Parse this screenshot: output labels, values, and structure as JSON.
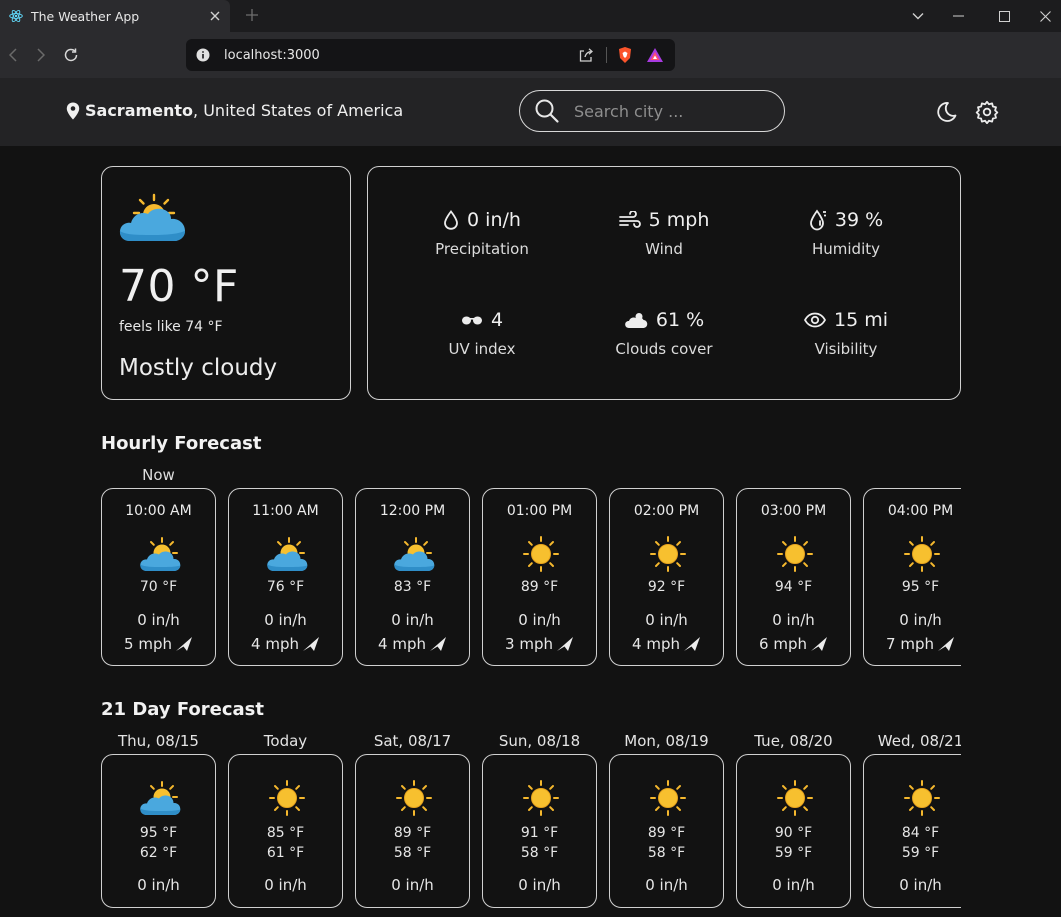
{
  "browser": {
    "tab_title": "The Weather App",
    "url": "localhost:3000"
  },
  "header": {
    "city": "Sacramento",
    "country": ", United States of America",
    "search_placeholder": "Search city ..."
  },
  "current": {
    "temperature": "70 °F",
    "feels_like": "feels like 74 °F",
    "condition": "Mostly cloudy",
    "icon": "partly-cloudy-icon"
  },
  "details": [
    {
      "value": "0 in/h",
      "label": "Precipitation",
      "icon": "droplet-icon"
    },
    {
      "value": "5 mph",
      "label": "Wind",
      "icon": "wind-icon"
    },
    {
      "value": "39 %",
      "label": "Humidity",
      "icon": "humidity-icon"
    },
    {
      "value": "4",
      "label": "UV index",
      "icon": "sunglasses-icon"
    },
    {
      "value": "61 %",
      "label": "Clouds cover",
      "icon": "cloud-sun-icon"
    },
    {
      "value": "15 mi",
      "label": "Visibility",
      "icon": "eye-icon"
    }
  ],
  "hourly": {
    "title": "Hourly Forecast",
    "now_label": "Now",
    "items": [
      {
        "time": "10:00 AM",
        "temp": "70 °F",
        "precip": "0 in/h",
        "wind": "5 mph",
        "icon": "partly-cloudy"
      },
      {
        "time": "11:00 AM",
        "temp": "76 °F",
        "precip": "0 in/h",
        "wind": "4 mph",
        "icon": "partly-cloudy"
      },
      {
        "time": "12:00 PM",
        "temp": "83 °F",
        "precip": "0 in/h",
        "wind": "4 mph",
        "icon": "partly-cloudy"
      },
      {
        "time": "01:00 PM",
        "temp": "89 °F",
        "precip": "0 in/h",
        "wind": "3 mph",
        "icon": "sun"
      },
      {
        "time": "02:00 PM",
        "temp": "92 °F",
        "precip": "0 in/h",
        "wind": "4 mph",
        "icon": "sun"
      },
      {
        "time": "03:00 PM",
        "temp": "94 °F",
        "precip": "0 in/h",
        "wind": "6 mph",
        "icon": "sun"
      },
      {
        "time": "04:00 PM",
        "temp": "95 °F",
        "precip": "0 in/h",
        "wind": "7 mph",
        "icon": "sun"
      }
    ]
  },
  "daily": {
    "title": "21 Day Forecast",
    "items": [
      {
        "day": "Thu, 08/15",
        "hi": "95 °F",
        "lo": "62 °F",
        "precip": "0 in/h",
        "icon": "partly-cloudy"
      },
      {
        "day": "Today",
        "hi": "85 °F",
        "lo": "61 °F",
        "precip": "0 in/h",
        "icon": "sun"
      },
      {
        "day": "Sat, 08/17",
        "hi": "89 °F",
        "lo": "58 °F",
        "precip": "0 in/h",
        "icon": "sun"
      },
      {
        "day": "Sun, 08/18",
        "hi": "91 °F",
        "lo": "58 °F",
        "precip": "0 in/h",
        "icon": "sun"
      },
      {
        "day": "Mon, 08/19",
        "hi": "89 °F",
        "lo": "58 °F",
        "precip": "0 in/h",
        "icon": "sun"
      },
      {
        "day": "Tue, 08/20",
        "hi": "90 °F",
        "lo": "59 °F",
        "precip": "0 in/h",
        "icon": "sun"
      },
      {
        "day": "Wed, 08/21",
        "hi": "84 °F",
        "lo": "59 °F",
        "precip": "0 in/h",
        "icon": "sun"
      }
    ]
  },
  "colors": {
    "sun": "#f5b82e",
    "cloud": "#3a9fd8",
    "background": "#121212"
  }
}
